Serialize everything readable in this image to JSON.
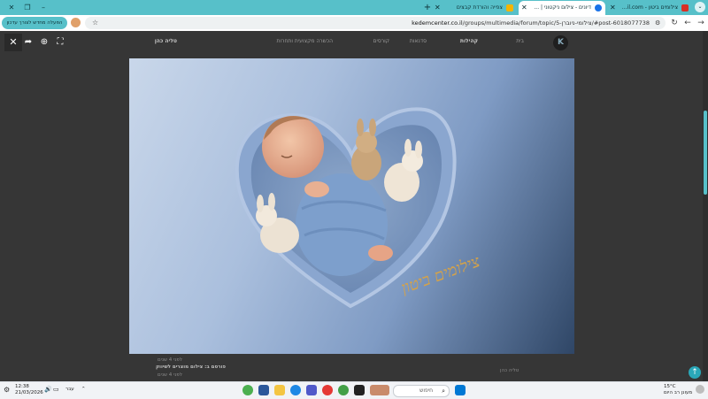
{
  "browser": {
    "tabs": [
      {
        "label": "צילומים ביטון - Gmail - ...ail.com",
        "icon_color": "#d93025",
        "active": false
      },
      {
        "label": "דיונים - צילום ניקטוני | ...",
        "icon_color": "#1a73e8",
        "active": true
      },
      {
        "label": "צפייה והורדת קבצים",
        "icon_color": "#f4b400",
        "active": false
      }
    ],
    "new_tab": "+",
    "url_prefix": "kedemcenter.co.il",
    "url_rest": "/groups/multimedia/forum/topic/5-צילומי-ניוברן/#post-6018077738",
    "ext_button": "הפעלה מחדש לצורך עדכון",
    "controls": {
      "minimize": "–",
      "restore": "❐",
      "close": "✕"
    }
  },
  "site_nav": {
    "items": [
      "בית",
      "קהילות",
      "סדנאות",
      "קורסים",
      "הכשרה מקצועית ותחרות",
      "טליה כהן"
    ],
    "logo": "K"
  },
  "lightbox": {
    "close_icon": "✕",
    "share_icon": "➦",
    "zoom_icon": "⊕",
    "fullscreen_icon": "⛶",
    "watermark": "צילומים ביטון"
  },
  "background_text": {
    "line1": "לפני 4 שנים",
    "line2_bold": "פורסם ב: צילום מוצרים לשיווק",
    "line3": "לפני 4 שנים",
    "author": "טליה כהן"
  },
  "taskbar": {
    "weather_temp": "15°C",
    "weather_desc": "מעונן רב היום",
    "search_placeholder": "חיפוש",
    "lang": "עבר",
    "time": "12:38",
    "date": "21/03/2026"
  },
  "colors": {
    "accent": "#57c0c9",
    "photo_blue": "#7f9bc4",
    "watermark_gold": "#d4a24a"
  }
}
